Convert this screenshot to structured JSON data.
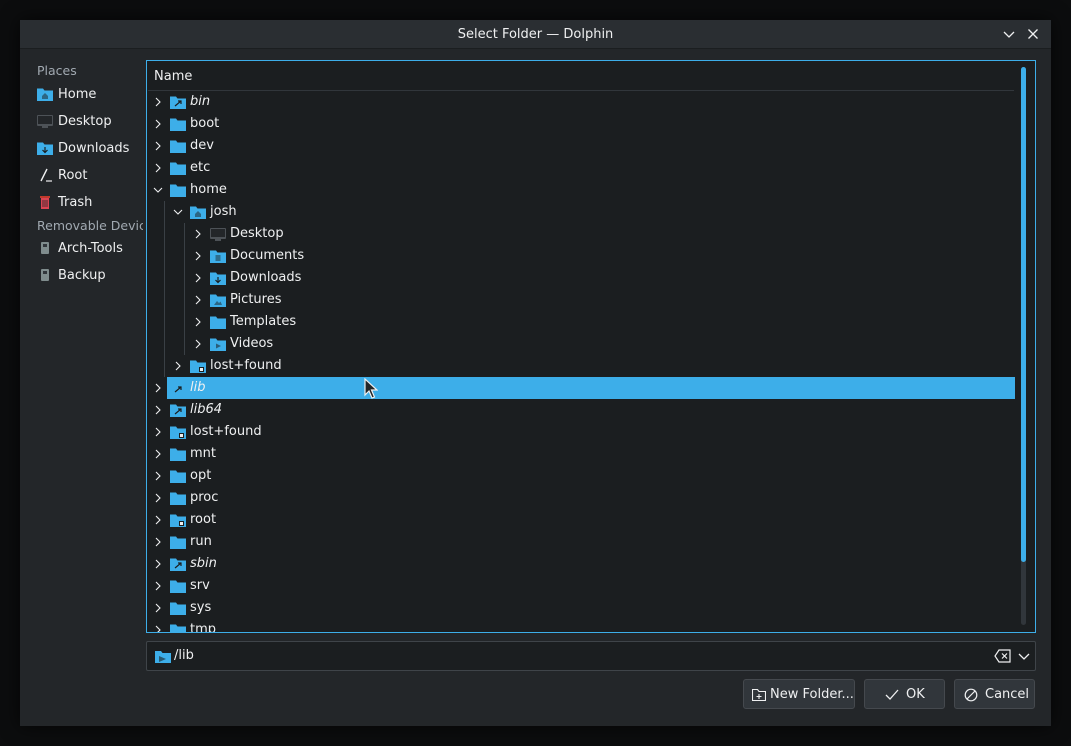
{
  "window": {
    "title": "Select Folder — Dolphin"
  },
  "places": {
    "section_title": "Places",
    "items": [
      {
        "label": "Home",
        "icon": "home-folder-icon"
      },
      {
        "label": "Desktop",
        "icon": "desktop-icon"
      },
      {
        "label": "Downloads",
        "icon": "downloads-folder-icon"
      },
      {
        "label": "Root",
        "icon": "root-icon"
      },
      {
        "label": "Trash",
        "icon": "trash-icon"
      }
    ],
    "removable_title": "Removable Devices",
    "devices": [
      {
        "label": "Arch-Tools",
        "icon": "drive-icon"
      },
      {
        "label": "Backup",
        "icon": "drive-icon"
      }
    ]
  },
  "tree": {
    "header": "Name",
    "rows": [
      {
        "name": "bin",
        "level": 0,
        "expanded": false,
        "italic": true,
        "icon": "folder-link"
      },
      {
        "name": "boot",
        "level": 0,
        "expanded": false,
        "italic": false,
        "icon": "folder"
      },
      {
        "name": "dev",
        "level": 0,
        "expanded": false,
        "italic": false,
        "icon": "folder"
      },
      {
        "name": "etc",
        "level": 0,
        "expanded": false,
        "italic": false,
        "icon": "folder"
      },
      {
        "name": "home",
        "level": 0,
        "expanded": true,
        "italic": false,
        "icon": "folder"
      },
      {
        "name": "josh",
        "level": 1,
        "expanded": true,
        "italic": false,
        "icon": "folder-home"
      },
      {
        "name": "Desktop",
        "level": 2,
        "expanded": false,
        "italic": false,
        "icon": "folder-desktop"
      },
      {
        "name": "Documents",
        "level": 2,
        "expanded": false,
        "italic": false,
        "icon": "folder-documents"
      },
      {
        "name": "Downloads",
        "level": 2,
        "expanded": false,
        "italic": false,
        "icon": "folder-downloads"
      },
      {
        "name": "Pictures",
        "level": 2,
        "expanded": false,
        "italic": false,
        "icon": "folder-pictures"
      },
      {
        "name": "Templates",
        "level": 2,
        "expanded": false,
        "italic": false,
        "icon": "folder"
      },
      {
        "name": "Videos",
        "level": 2,
        "expanded": false,
        "italic": false,
        "icon": "folder-videos"
      },
      {
        "name": "lost+found",
        "level": 1,
        "expanded": false,
        "italic": false,
        "icon": "folder-locked"
      },
      {
        "name": "lib",
        "level": 0,
        "expanded": false,
        "italic": true,
        "icon": "folder-link",
        "selected": true
      },
      {
        "name": "lib64",
        "level": 0,
        "expanded": false,
        "italic": true,
        "icon": "folder-link"
      },
      {
        "name": "lost+found",
        "level": 0,
        "expanded": false,
        "italic": false,
        "icon": "folder-locked"
      },
      {
        "name": "mnt",
        "level": 0,
        "expanded": false,
        "italic": false,
        "icon": "folder"
      },
      {
        "name": "opt",
        "level": 0,
        "expanded": false,
        "italic": false,
        "icon": "folder"
      },
      {
        "name": "proc",
        "level": 0,
        "expanded": false,
        "italic": false,
        "icon": "folder"
      },
      {
        "name": "root",
        "level": 0,
        "expanded": false,
        "italic": false,
        "icon": "folder-locked"
      },
      {
        "name": "run",
        "level": 0,
        "expanded": false,
        "italic": false,
        "icon": "folder"
      },
      {
        "name": "sbin",
        "level": 0,
        "expanded": false,
        "italic": true,
        "icon": "folder-link"
      },
      {
        "name": "srv",
        "level": 0,
        "expanded": false,
        "italic": false,
        "icon": "folder"
      },
      {
        "name": "sys",
        "level": 0,
        "expanded": false,
        "italic": false,
        "icon": "folder"
      },
      {
        "name": "tmp",
        "level": 0,
        "expanded": false,
        "italic": false,
        "icon": "folder"
      }
    ]
  },
  "location": {
    "value": "/lib"
  },
  "buttons": {
    "new_folder": "New Folder...",
    "ok": "OK",
    "cancel": "Cancel"
  },
  "colors": {
    "accent": "#3daee9",
    "background": "#232629",
    "view_bg": "#1b1e20"
  }
}
